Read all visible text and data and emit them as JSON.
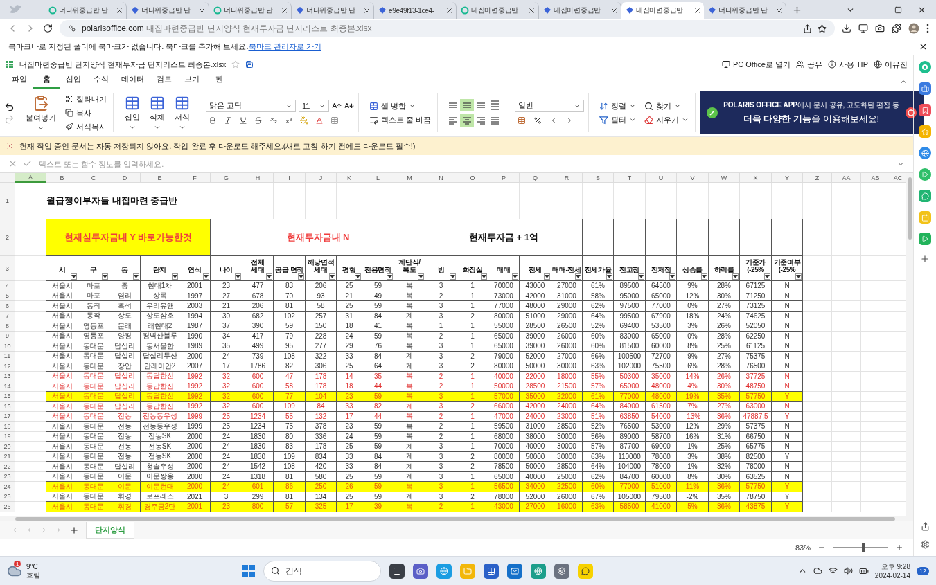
{
  "browser": {
    "tabs": [
      {
        "title": "너나위중급반 단",
        "kind": "ring",
        "selected": false
      },
      {
        "title": "너나위중급반 단",
        "kind": "polaris",
        "selected": false
      },
      {
        "title": "너나위중급반 단",
        "kind": "ring",
        "selected": false
      },
      {
        "title": "너나위중급반 단",
        "kind": "polaris",
        "selected": false
      },
      {
        "title": "e9e49f13-1ce4-",
        "kind": "polaris",
        "selected": false
      },
      {
        "title": "내집마련중급반",
        "kind": "ring",
        "selected": false
      },
      {
        "title": "내집마련중급반",
        "kind": "polaris",
        "selected": false
      },
      {
        "title": "내집마련중급반",
        "kind": "polaris",
        "selected": true
      },
      {
        "title": "너나위중급반 단",
        "kind": "polaris",
        "selected": false
      }
    ],
    "address": {
      "domain": "polarisoffice.com",
      "path": "내집마련중급반 단지양식 현재투자금 단지리스트 최종본.xlsx"
    },
    "bookmark_bar": {
      "message": "북마크바로 지정된 폴더에 북마크가 없습니다. 북마크를 추가해 보세요.",
      "link": "북마크 관리자로 가기"
    }
  },
  "app": {
    "filename": "내집마련중급반 단지양식 현재투자금 단지리스트 최종본.xlsx",
    "actions": [
      "PC Office로 열기",
      "공유",
      "사용 TIP",
      "이유진"
    ]
  },
  "menu": [
    {
      "label": "파일",
      "selected": false
    },
    {
      "label": "홈",
      "selected": true
    },
    {
      "label": "삽입",
      "selected": false
    },
    {
      "label": "수식",
      "selected": false
    },
    {
      "label": "데이터",
      "selected": false
    },
    {
      "label": "검토",
      "selected": false
    },
    {
      "label": "보기",
      "selected": false
    },
    {
      "label": "펜",
      "selected": false
    }
  ],
  "ribbon": {
    "paste": "붙여넣기",
    "clipboard": [
      "잘라내기",
      "복사",
      "서식복사"
    ],
    "cells": [
      "삽입",
      "삭제",
      "서식"
    ],
    "font": {
      "name": "맑은 고딕",
      "size": "11"
    },
    "merge": "셀 병합",
    "wrap": "텍스트 줄 바꿈",
    "alignment": [
      {
        "kind": "top",
        "selected": false
      },
      {
        "kind": "middle",
        "selected": true
      },
      {
        "kind": "bottom",
        "selected": false
      },
      {
        "kind": "distribute",
        "selected": false
      },
      {
        "kind": "left",
        "selected": false
      },
      {
        "kind": "center",
        "selected": true
      },
      {
        "kind": "right",
        "selected": false
      },
      {
        "kind": "justify",
        "selected": false
      }
    ],
    "number_format": "일반",
    "data": [
      "정렬",
      "필터"
    ],
    "edit": [
      "찾기",
      "지우기"
    ],
    "banner": {
      "line1": "**POLARIS OFFICE APP**에서 문서 공유, 고도화된 편집 등",
      "line2": "**더욱 다양한 기능**을 이용해보세요!"
    }
  },
  "notice": "현재 작업 중인 문서는 자동 저장되지 않아요. 작업 완료 후 다운로드 해주세요.(새로 고침 하기 전에도 다운로드 필수!)",
  "formula_bar": {
    "placeholder": "텍스트 또는 함수 정보를 입력하세요."
  },
  "sheet": {
    "letter_headers": [
      {
        "label": "A",
        "selected": true
      },
      {
        "label": "B",
        "selected": false
      },
      {
        "label": "C",
        "selected": false
      },
      {
        "label": "D",
        "selected": false
      },
      {
        "label": "E",
        "selected": false
      },
      {
        "label": "F",
        "selected": false
      },
      {
        "label": "G",
        "selected": false
      },
      {
        "label": "H",
        "selected": false
      },
      {
        "label": "I",
        "selected": false
      },
      {
        "label": "J",
        "selected": false
      },
      {
        "label": "K",
        "selected": false
      },
      {
        "label": "L",
        "selected": false
      },
      {
        "label": "M",
        "selected": false
      },
      {
        "label": "N",
        "selected": false
      },
      {
        "label": "O",
        "selected": false
      },
      {
        "label": "P",
        "selected": false
      },
      {
        "label": "Q",
        "selected": false
      },
      {
        "label": "R",
        "selected": false
      },
      {
        "label": "S",
        "selected": false
      },
      {
        "label": "T",
        "selected": false
      },
      {
        "label": "U",
        "selected": false
      },
      {
        "label": "V",
        "selected": false
      },
      {
        "label": "W",
        "selected": false
      },
      {
        "label": "X",
        "selected": false
      },
      {
        "label": "Y",
        "selected": false
      },
      {
        "label": "Z",
        "selected": false
      },
      {
        "label": "AA",
        "selected": false
      },
      {
        "label": "AB",
        "selected": false
      },
      {
        "label": "AC",
        "selected": false
      }
    ],
    "title": {
      "row": "1",
      "text": "월급쟁이부자들 내집마련 중급반"
    },
    "sections": {
      "row": "2",
      "items": [
        {
          "label": "현재실투자금내 Y 바로가능한것",
          "highlight": true,
          "red_text": true
        },
        {
          "label": "현재투자금내 N",
          "highlight": false,
          "red_text": true
        },
        {
          "label": "현재투자금 + 1억",
          "highlight": false,
          "red_text": false
        }
      ]
    },
    "headers": {
      "row": "3",
      "labels": [
        "시",
        "구",
        "동",
        "단지",
        "연식",
        "나이",
        "전체\n세대",
        "공급 면적",
        "해당면적\n세대",
        "평형",
        "전용면적",
        "계단식/\n복도",
        "방",
        "화장실",
        "매매",
        "전세",
        "매매-전세",
        "전세가율",
        "전고점",
        "전저점",
        "상승률",
        "하락률",
        "기준가\n(-25%",
        "기준여부\n(-25%"
      ]
    },
    "rows": [
      {
        "number": "4",
        "kind": "plain",
        "cells": [
          "서울시",
          "마포",
          "중",
          "현대1차",
          "2001",
          "23",
          "477",
          "83",
          "206",
          "25",
          "59",
          "복",
          "3",
          "1",
          "70000",
          "43000",
          "27000",
          "61%",
          "89500",
          "64500",
          "9%",
          "28%",
          "67125",
          "N"
        ]
      },
      {
        "number": "5",
        "kind": "plain",
        "cells": [
          "서울시",
          "마포",
          "염리",
          "상록",
          "1997",
          "27",
          "678",
          "70",
          "93",
          "21",
          "49",
          "복",
          "2",
          "1",
          "73000",
          "42000",
          "31000",
          "58%",
          "95000",
          "65000",
          "12%",
          "30%",
          "71250",
          "N"
        ]
      },
      {
        "number": "6",
        "kind": "plain",
        "cells": [
          "서울시",
          "동작",
          "흑석",
          "우리유앤",
          "2003",
          "21",
          "206",
          "81",
          "58",
          "25",
          "59",
          "복",
          "3",
          "1",
          "77000",
          "48000",
          "29000",
          "62%",
          "97500",
          "77000",
          "0%",
          "27%",
          "73125",
          "N"
        ]
      },
      {
        "number": "7",
        "kind": "plain",
        "cells": [
          "서울시",
          "동작",
          "상도",
          "상도삼호",
          "1994",
          "30",
          "682",
          "102",
          "257",
          "31",
          "84",
          "계",
          "3",
          "2",
          "80000",
          "51000",
          "29000",
          "64%",
          "99500",
          "67900",
          "18%",
          "24%",
          "74625",
          "N"
        ]
      },
      {
        "number": "8",
        "kind": "plain",
        "cells": [
          "서울시",
          "영등포",
          "문래",
          "래현대2",
          "1987",
          "37",
          "390",
          "59",
          "150",
          "18",
          "41",
          "복",
          "1",
          "1",
          "55000",
          "28500",
          "26500",
          "52%",
          "69400",
          "53500",
          "3%",
          "26%",
          "52050",
          "N"
        ]
      },
      {
        "number": "9",
        "kind": "plain",
        "cells": [
          "서울시",
          "영등포",
          "양평",
          "평벽산블루",
          "1990",
          "34",
          "417",
          "79",
          "228",
          "24",
          "59",
          "복",
          "2",
          "1",
          "65000",
          "39000",
          "26000",
          "60%",
          "83000",
          "65000",
          "0%",
          "28%",
          "62250",
          "N"
        ]
      },
      {
        "number": "10",
        "kind": "plain",
        "cells": [
          "서울시",
          "동대문",
          "답십리",
          "동서울한",
          "1989",
          "35",
          "499",
          "95",
          "277",
          "29",
          "76",
          "복",
          "3",
          "1",
          "65000",
          "39000",
          "26000",
          "60%",
          "81500",
          "60000",
          "8%",
          "25%",
          "61125",
          "N"
        ]
      },
      {
        "number": "11",
        "kind": "plain",
        "cells": [
          "서울시",
          "동대문",
          "답십리",
          "답십리두산",
          "2000",
          "24",
          "739",
          "108",
          "322",
          "33",
          "84",
          "계",
          "3",
          "2",
          "79000",
          "52000",
          "27000",
          "66%",
          "100500",
          "72700",
          "9%",
          "27%",
          "75375",
          "N"
        ]
      },
      {
        "number": "12",
        "kind": "plain",
        "cells": [
          "서울시",
          "동대문",
          "장안",
          "안래미안2",
          "2007",
          "17",
          "1786",
          "82",
          "306",
          "25",
          "64",
          "계",
          "3",
          "2",
          "80000",
          "50000",
          "30000",
          "63%",
          "102000",
          "75500",
          "6%",
          "28%",
          "76500",
          "N"
        ]
      },
      {
        "number": "13",
        "kind": "red",
        "cells": [
          "서울시",
          "동대문",
          "답십리",
          "동답한신",
          "1992",
          "32",
          "600",
          "47",
          "178",
          "14",
          "35",
          "복",
          "2",
          "1",
          "40000",
          "22000",
          "18000",
          "55%",
          "50300",
          "35000",
          "14%",
          "26%",
          "37725",
          "N"
        ]
      },
      {
        "number": "14",
        "kind": "red",
        "cells": [
          "서울시",
          "동대문",
          "답십리",
          "동답한신",
          "1992",
          "32",
          "600",
          "58",
          "178",
          "18",
          "44",
          "복",
          "2",
          "1",
          "50000",
          "28500",
          "21500",
          "57%",
          "65000",
          "48000",
          "4%",
          "30%",
          "48750",
          "N"
        ]
      },
      {
        "number": "15",
        "kind": "highlight",
        "cells": [
          "서울시",
          "동대문",
          "답십리",
          "동답한신",
          "1992",
          "32",
          "600",
          "77",
          "104",
          "23",
          "59",
          "복",
          "3",
          "1",
          "57000",
          "35000",
          "22000",
          "61%",
          "77000",
          "48000",
          "19%",
          "35%",
          "57750",
          "Y"
        ]
      },
      {
        "number": "16",
        "kind": "red",
        "cells": [
          "서울시",
          "동대문",
          "답십리",
          "동답한신",
          "1992",
          "32",
          "600",
          "109",
          "84",
          "33",
          "82",
          "계",
          "3",
          "2",
          "66000",
          "42000",
          "24000",
          "64%",
          "84000",
          "61500",
          "7%",
          "27%",
          "63000",
          "N"
        ]
      },
      {
        "number": "17",
        "kind": "red",
        "cells": [
          "서울시",
          "동대문",
          "전농",
          "전농동우성",
          "1999",
          "25",
          "1234",
          "55",
          "132",
          "17",
          "44",
          "복",
          "2",
          "1",
          "47000",
          "24000",
          "23000",
          "51%",
          "63850",
          "54000",
          "-13%",
          "36%",
          "47887.5",
          "Y"
        ]
      },
      {
        "number": "18",
        "kind": "plain",
        "cells": [
          "서울시",
          "동대문",
          "전농",
          "전농동우성",
          "1999",
          "25",
          "1234",
          "75",
          "378",
          "23",
          "59",
          "복",
          "2",
          "1",
          "59500",
          "31000",
          "28500",
          "52%",
          "76500",
          "53000",
          "12%",
          "29%",
          "57375",
          "N"
        ]
      },
      {
        "number": "19",
        "kind": "plain",
        "cells": [
          "서울시",
          "동대문",
          "전농",
          "전농SK",
          "2000",
          "24",
          "1830",
          "80",
          "336",
          "24",
          "59",
          "복",
          "2",
          "1",
          "68000",
          "38000",
          "30000",
          "56%",
          "89000",
          "58700",
          "16%",
          "31%",
          "66750",
          "N"
        ]
      },
      {
        "number": "20",
        "kind": "plain",
        "cells": [
          "서울시",
          "동대문",
          "전농",
          "전농SK",
          "2000",
          "24",
          "1830",
          "83",
          "178",
          "25",
          "59",
          "계",
          "3",
          "1",
          "70000",
          "40000",
          "30000",
          "57%",
          "87700",
          "69000",
          "1%",
          "25%",
          "65775",
          "N"
        ]
      },
      {
        "number": "21",
        "kind": "plain",
        "cells": [
          "서울시",
          "동대문",
          "전농",
          "전농SK",
          "2000",
          "24",
          "1830",
          "109",
          "834",
          "33",
          "84",
          "계",
          "3",
          "2",
          "80000",
          "50000",
          "30000",
          "63%",
          "110000",
          "78000",
          "3%",
          "38%",
          "82500",
          "Y"
        ]
      },
      {
        "number": "22",
        "kind": "plain",
        "cells": [
          "서울시",
          "동대문",
          "답십리",
          "청솔우성",
          "2000",
          "24",
          "1542",
          "108",
          "420",
          "33",
          "84",
          "계",
          "3",
          "2",
          "78500",
          "50000",
          "28500",
          "64%",
          "104000",
          "78000",
          "1%",
          "32%",
          "78000",
          "N"
        ]
      },
      {
        "number": "23",
        "kind": "plain",
        "cells": [
          "서울시",
          "동대문",
          "이문",
          "이문쌍용",
          "2000",
          "24",
          "1318",
          "81",
          "580",
          "25",
          "59",
          "계",
          "3",
          "1",
          "65000",
          "40000",
          "25000",
          "62%",
          "84700",
          "60000",
          "8%",
          "30%",
          "63525",
          "N"
        ]
      },
      {
        "number": "24",
        "kind": "highlight",
        "cells": [
          "서울시",
          "동대문",
          "이문",
          "이문현대",
          "2000",
          "24",
          "601",
          "86",
          "250",
          "26",
          "59",
          "복",
          "3",
          "1",
          "56500",
          "34000",
          "22500",
          "60%",
          "77000",
          "51000",
          "11%",
          "36%",
          "57750",
          "Y"
        ]
      },
      {
        "number": "25",
        "kind": "plain",
        "cells": [
          "서울시",
          "동대문",
          "휘경",
          "로프레스",
          "2021",
          "3",
          "299",
          "81",
          "134",
          "25",
          "59",
          "계",
          "3",
          "2",
          "78000",
          "52000",
          "26000",
          "67%",
          "105000",
          "79500",
          "-2%",
          "35%",
          "78750",
          "Y"
        ]
      },
      {
        "number": "26",
        "kind": "highlight",
        "cells": [
          "서울시",
          "동대문",
          "휘경",
          "경주공2단",
          "2001",
          "23",
          "800",
          "57",
          "325",
          "17",
          "39",
          "복",
          "2",
          "1",
          "43000",
          "27000",
          "16000",
          "63%",
          "58500",
          "41000",
          "5%",
          "36%",
          "43875",
          "Y"
        ]
      }
    ]
  },
  "sheet_tabs": [
    {
      "label": "단지양식",
      "selected": true
    }
  ],
  "zoom": "83%",
  "zoom_slider": {
    "level": 0.55
  },
  "taskbar": {
    "weather": {
      "badge": "1",
      "temperature": "9°C",
      "condition": "흐림"
    },
    "search": {
      "placeholder": "검색"
    },
    "time": "오후 9:28",
    "date": "2024-02-14",
    "notifications": "12"
  }
}
